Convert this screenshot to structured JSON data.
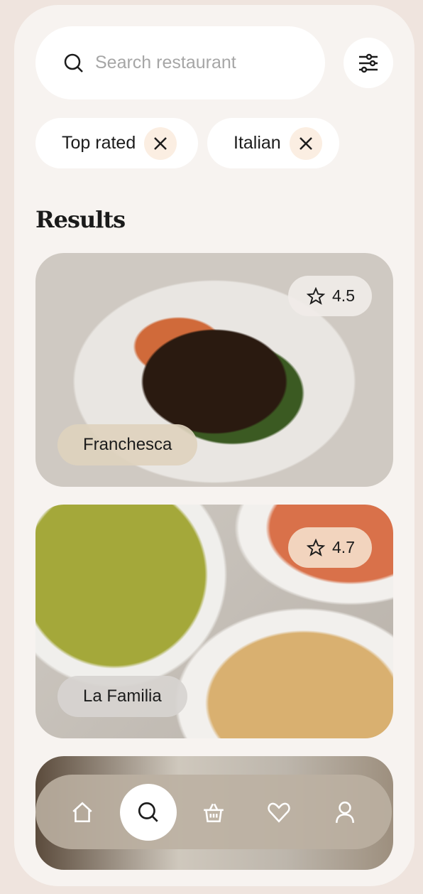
{
  "search": {
    "placeholder": "Search restaurant",
    "icon": "search-icon"
  },
  "filter_button": {
    "icon": "sliders-icon"
  },
  "chips": [
    {
      "label": "Top rated"
    },
    {
      "label": "Italian"
    }
  ],
  "results": {
    "title": "Results",
    "items": [
      {
        "name": "Franchesca",
        "rating": "4.5"
      },
      {
        "name": "La Familia",
        "rating": "4.7"
      }
    ]
  },
  "nav": {
    "items": [
      "home-icon",
      "search-icon",
      "basket-icon",
      "heart-icon",
      "user-icon"
    ],
    "active": "search"
  },
  "colors": {
    "background": "#efe4de",
    "surface": "#f7f3f0",
    "chip_close": "#fbeee2"
  }
}
